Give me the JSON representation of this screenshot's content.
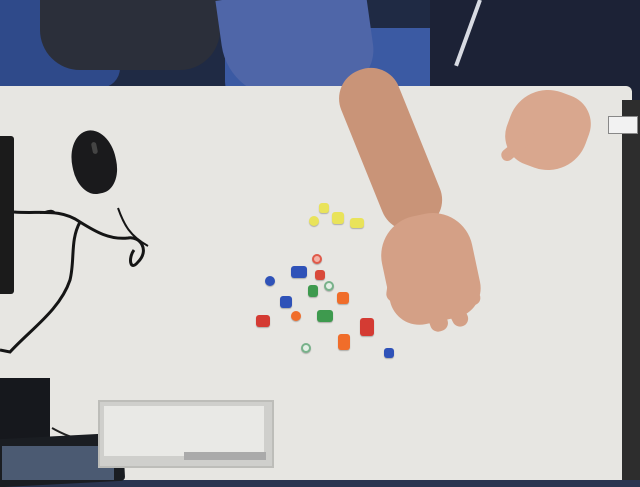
{
  "scene": {
    "description_hidden": "",
    "colors": {
      "table": "#e7e6e2",
      "yellow": "#e9e35a",
      "red": "#d43b33",
      "blue": "#2f52b8",
      "green": "#3e9a4e",
      "orange": "#f06d2a",
      "teal_ring": "#8ab9a0"
    }
  }
}
